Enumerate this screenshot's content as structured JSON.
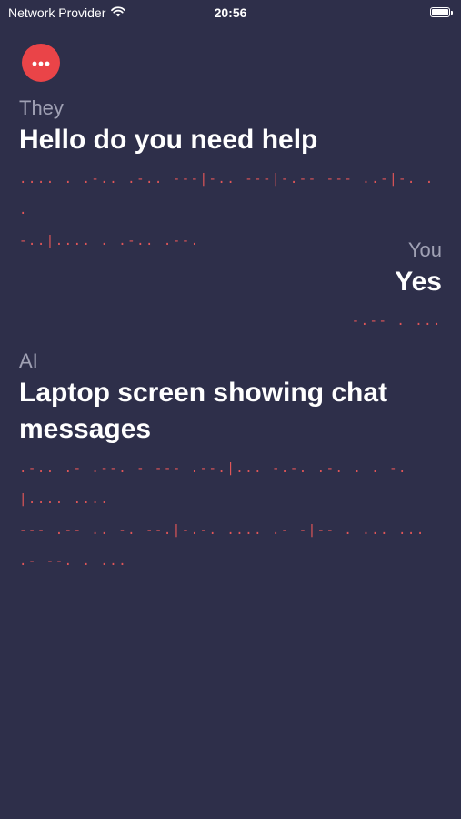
{
  "status_bar": {
    "carrier": "Network Provider",
    "time": "20:56"
  },
  "colors": {
    "background": "#2e2f4a",
    "accent": "#ea4448",
    "morse": "#e05658",
    "speaker": "#a0a1b4"
  },
  "messages": [
    {
      "speaker": "They",
      "text": "Hello do you need help",
      "morse_lines": [
        ".... . .-.. .-.. ---|-.. ---|-.-- --- ..-|-. . .",
        "-..|.... . .-.. .--."
      ]
    },
    {
      "speaker": "You",
      "text": "Yes",
      "morse_lines": [
        "-.-- . ..."
      ]
    },
    {
      "speaker": "AI",
      "text": "Laptop screen showing chat messages",
      "morse_lines": [
        ".-.. .- .--. - --- .--.|... -.-. .-. . . -.|.... ....",
        "--- .-- .. -. --.|-.-. .... .- -|-- . ... ... .- --. . ..."
      ]
    }
  ],
  "icons": {
    "menu": "ellipsis-icon",
    "wifi": "wifi-icon",
    "battery": "battery-icon"
  }
}
